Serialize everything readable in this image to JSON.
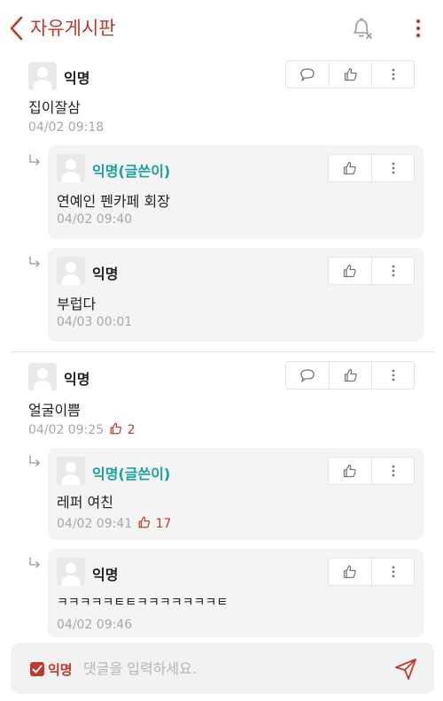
{
  "header": {
    "title": "자유게시판"
  },
  "comments": [
    {
      "name": "익명",
      "text": "집이잘삼",
      "time": "04/02 09:18",
      "replies": [
        {
          "name": "익명(글쓴이)",
          "text": "연예인 펜카페 회장",
          "time": "04/02 09:40"
        },
        {
          "name": "익명",
          "text": "부럽다",
          "time": "04/03 00:01"
        }
      ]
    },
    {
      "name": "익명",
      "text": "얼굴이쁨",
      "time": "04/02 09:25",
      "likes": "2",
      "replies": [
        {
          "name": "익명(글쓴이)",
          "text": "레퍼 여친",
          "time": "04/02 09:41",
          "likes": "17"
        },
        {
          "name": "익명",
          "text": "ㅋㅋㅋㅋㅋㅌㅌㅋㅋㅋㅋㅋㅋㅋㅌ",
          "time": "04/02 09:46"
        }
      ]
    }
  ],
  "composer": {
    "anonymous_label": "익명",
    "placeholder": "댓글을 입력하세요."
  },
  "colors": {
    "accent": "#c0392b",
    "op_name": "#1aa0a0",
    "reply_bg": "#f4f4f4",
    "muted": "#a7a7a7"
  },
  "icons": [
    "chevron-left-icon",
    "bell-off-icon",
    "more-vertical-icon",
    "speech-bubble-icon",
    "thumbs-up-icon",
    "reply-arrow-icon",
    "check-icon",
    "send-icon"
  ]
}
